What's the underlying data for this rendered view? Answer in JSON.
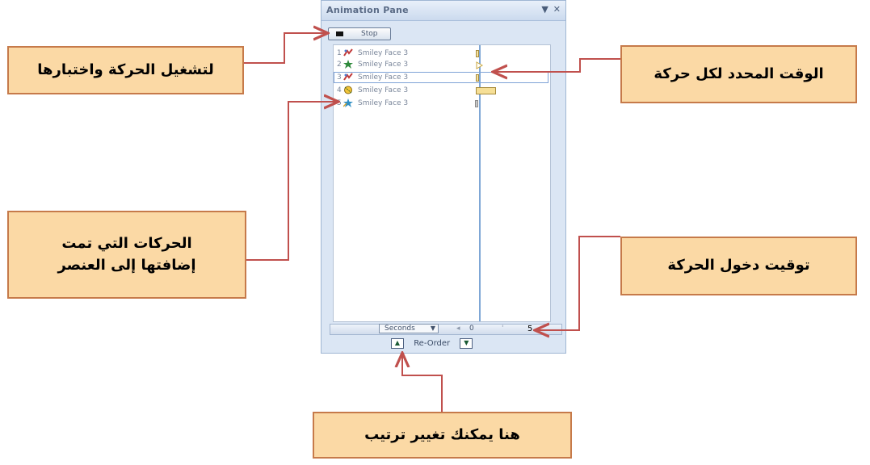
{
  "pane": {
    "title": "Animation Pane",
    "play_label": "Stop",
    "animations": [
      {
        "num": "1",
        "name": "Smiley Face 3",
        "icon": "entrance-effect-icon",
        "color": "#c23a3a"
      },
      {
        "num": "2",
        "name": "Smiley Face 3",
        "icon": "emphasis-effect-icon",
        "color": "#2f8a3c"
      },
      {
        "num": "3",
        "name": "Smiley Face 3",
        "icon": "entrance-effect-icon",
        "color": "#c23a3a"
      },
      {
        "num": "4",
        "name": "Smiley Face 3",
        "icon": "motion-path-icon",
        "color": "#d8a21c"
      },
      {
        "num": "5",
        "name": "Smiley Face 3",
        "icon": "exit-effect-icon",
        "color": "#2f8fc4"
      }
    ],
    "seconds_label": "Seconds",
    "time_start": "0",
    "time_end": "5",
    "reorder_label": "Re-Order"
  },
  "callouts": {
    "play": "لتشغيل الحركة واختبارها",
    "time_per_animation": "الوقت المحدد لكل حركة",
    "added_animations_line1": "الحركات التي تمت",
    "added_animations_line2": "إضافتها إلى العنصر",
    "entry_timing": "توقيت دخول الحركة",
    "reorder": "هنا يمكنك تغيير ترتيب"
  },
  "colors": {
    "callout_fill": "#fbd9a5",
    "callout_border": "#c67a4a",
    "arrow": "#c0504d"
  }
}
